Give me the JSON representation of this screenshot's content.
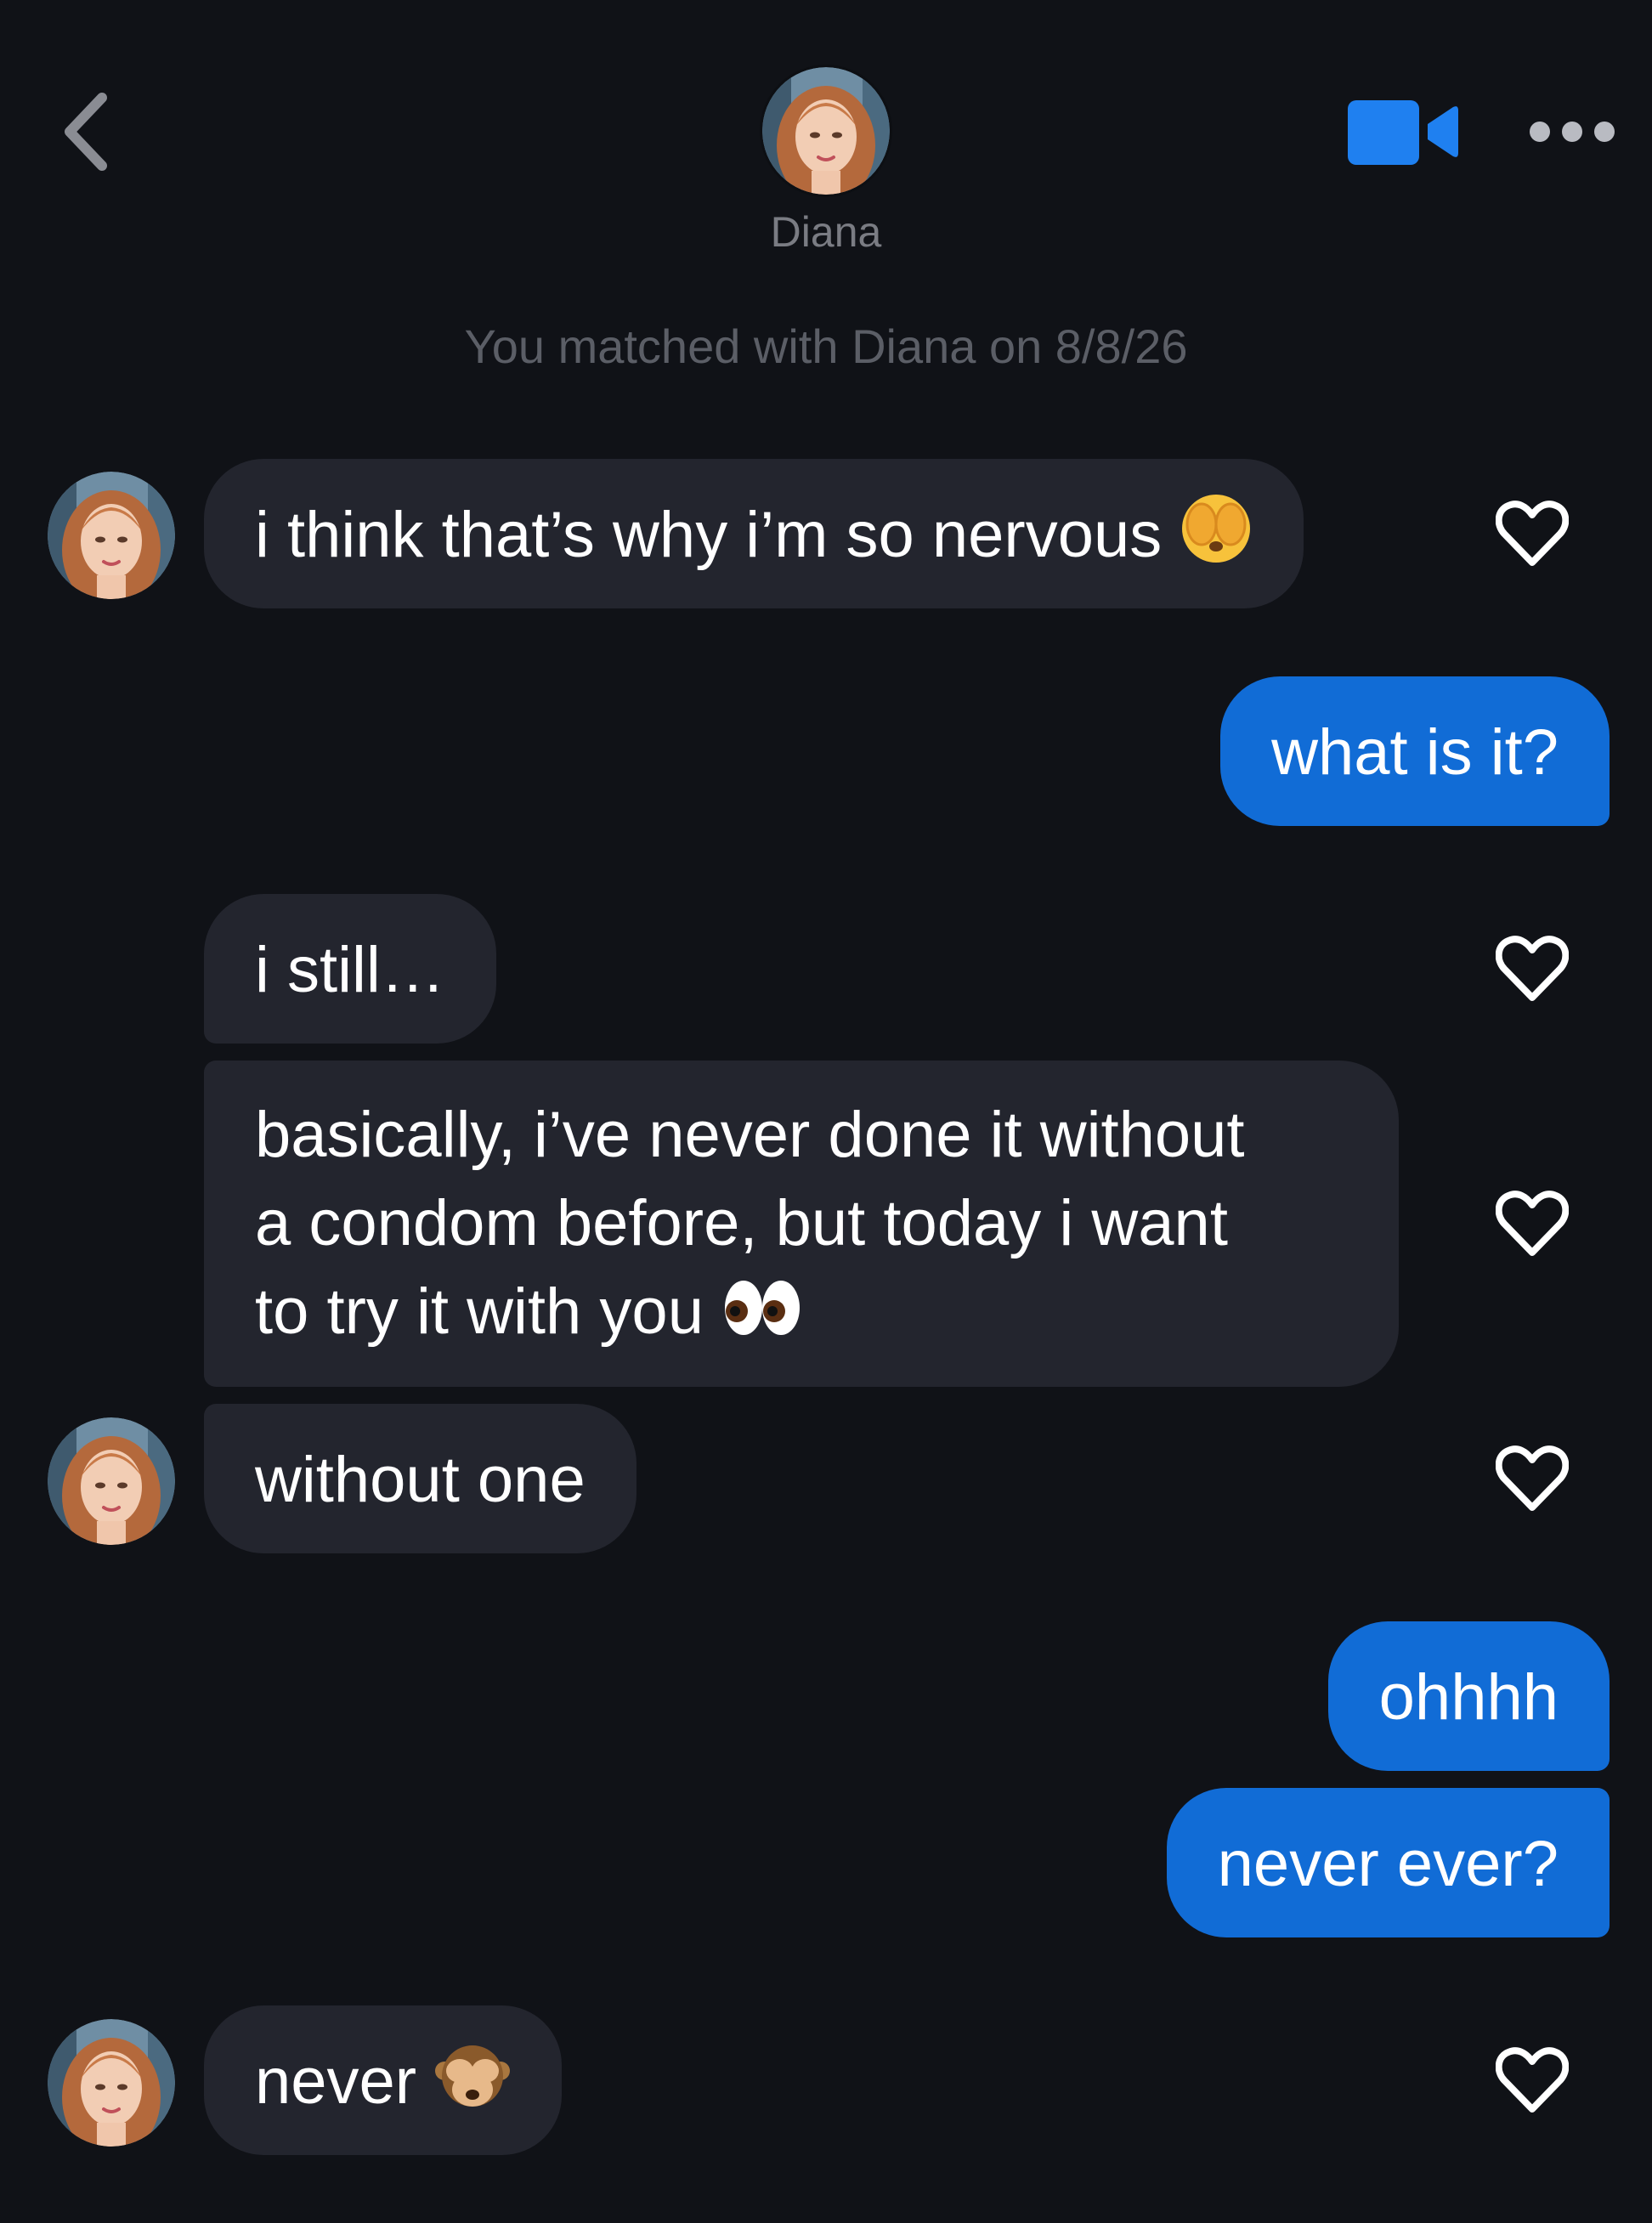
{
  "header": {
    "contact_name": "Diana",
    "back_icon": "chevron-left-icon",
    "video_icon": "video-camera-icon",
    "more_icon": "more-dots-icon"
  },
  "match_note": "You matched with Diana on 8/8/26",
  "colors": {
    "background": "#101217",
    "incoming_bubble": "#23252e",
    "outgoing_bubble": "#116cd6",
    "accent": "#1f80f0",
    "muted_text": "#5b5e66"
  },
  "messages": [
    {
      "sender": "Diana",
      "direction": "incoming",
      "text": "i think that’s why i’m so nervous",
      "emoji": "face-with-hands-over-eyes",
      "like_icon": "heart-icon"
    },
    {
      "sender": "me",
      "direction": "outgoing",
      "text": "what is it?"
    },
    {
      "sender": "Diana",
      "direction": "incoming",
      "text": "i still…",
      "like_icon": "heart-icon"
    },
    {
      "sender": "Diana",
      "direction": "incoming",
      "lines": [
        "basically, i’ve never done it without",
        "a condom before, but today i want",
        "to try it with you"
      ],
      "emoji": "eyes",
      "like_icon": "heart-icon"
    },
    {
      "sender": "Diana",
      "direction": "incoming",
      "text": "without one",
      "like_icon": "heart-icon"
    },
    {
      "sender": "me",
      "direction": "outgoing",
      "text": "ohhhh"
    },
    {
      "sender": "me",
      "direction": "outgoing",
      "text": "never ever?"
    },
    {
      "sender": "Diana",
      "direction": "incoming",
      "text": "never",
      "emoji": "see-no-evil-monkey",
      "like_icon": "heart-icon"
    }
  ]
}
